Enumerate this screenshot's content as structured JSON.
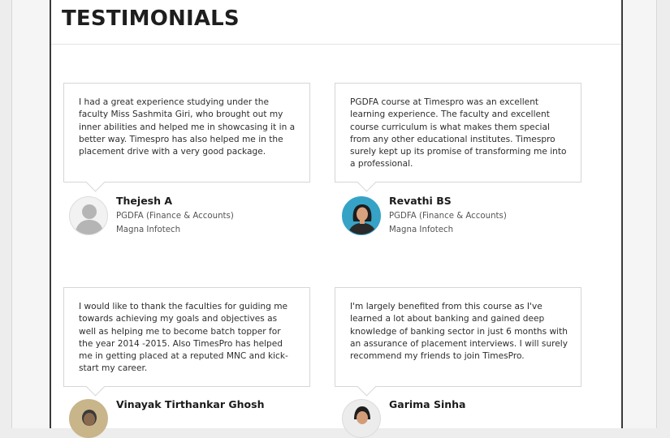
{
  "section": {
    "title": "TESTIMONIALS"
  },
  "testimonials": [
    {
      "quote": "I had a great experience studying under the faculty Miss Sashmita Giri, who brought out my inner abilities and helped me in showcasing it in a better way. Timespro has also helped me in the placement drive with a very good package.",
      "name": "Thejesh A",
      "course": "PGDFA (Finance & Accounts)",
      "company": "Magna Infotech",
      "avatar": "placeholder-user-icon"
    },
    {
      "quote": "PGDFA course at Timespro was an excellent learning experience. The faculty and excellent course curriculum is what makes them special from any other educational institutes. Timespro surely kept up its promise of transforming me into a professional.",
      "name": "Revathi BS",
      "course": "PGDFA (Finance & Accounts)",
      "company": "Magna Infotech",
      "avatar": "user-photo"
    },
    {
      "quote": "I would like to thank the faculties for guiding me towards achieving my goals and objectives as well as helping me to become batch topper for the year 2014 -2015. Also TimesPro has helped me in getting placed at a reputed MNC and kick-start my career.",
      "name": "Vinayak Tirthankar Ghosh",
      "avatar": "user-photo"
    },
    {
      "quote": "I'm largely benefited from this course as I've learned a lot about banking and gained deep knowledge of banking sector in just 6 months with an assurance of placement interviews. I will surely recommend my friends to join TimesPro.",
      "name": "Garima Sinha",
      "avatar": "user-photo"
    }
  ]
}
